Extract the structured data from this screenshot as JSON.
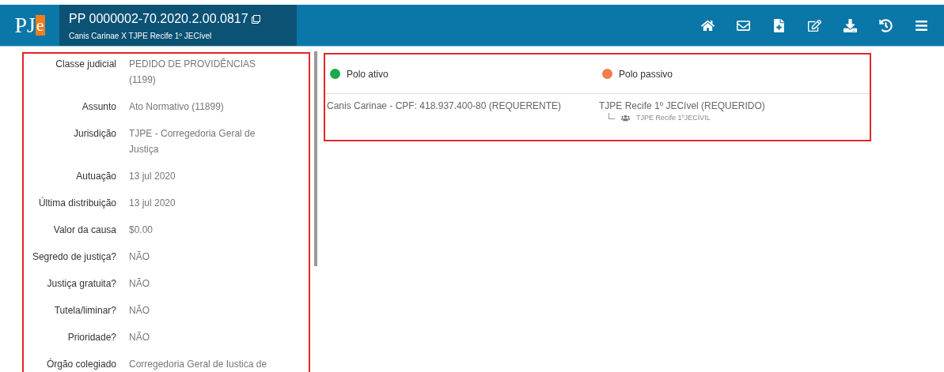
{
  "header": {
    "logo": {
      "p": "PJ",
      "e": "e"
    },
    "process_number": "PP 0000002-70.2020.2.00.0817",
    "parties": "Canis Carinae X TJPE Recife 1º JECível",
    "actions": [
      {
        "kind": "home"
      },
      {
        "kind": "mail"
      },
      {
        "kind": "document"
      },
      {
        "kind": "edit"
      },
      {
        "kind": "download"
      },
      {
        "kind": "history"
      },
      {
        "kind": "menu"
      }
    ]
  },
  "details": [
    {
      "label": "Classe judicial",
      "value": "PEDIDO DE PROVIDÊNCIAS (1199)"
    },
    {
      "label": "Assunto",
      "value": "Ato Normativo (11899)"
    },
    {
      "label": "Jurisdição",
      "value": "TJPE - Corregedoria Geral de Justiça"
    },
    {
      "label": "Autuação",
      "value": "13 jul 2020"
    },
    {
      "label": "Última distribuição",
      "value": "13 jul 2020"
    },
    {
      "label": "Valor da causa",
      "value": "$0.00"
    },
    {
      "label": "Segredo de justiça?",
      "value": "NÃO"
    },
    {
      "label": "Justiça gratuita?",
      "value": "NÃO"
    },
    {
      "label": "Tutela/liminar?",
      "value": "NÃO"
    },
    {
      "label": "Prioridade?",
      "value": "NÃO"
    },
    {
      "label": "Órgão colegiado",
      "value": "Corregedoria Geral de Iustica de"
    }
  ],
  "poles": [
    {
      "title": "Polo ativo",
      "color": "#1ea84a",
      "party": "Canis Carinae - CPF: 418.937.400-80 (REQUERENTE)"
    },
    {
      "title": "Polo passivo",
      "color": "#ef7d4e",
      "party": "TJPE Recife 1º JECível (REQUERIDO)",
      "representative": "TJPE Recife 1ºJECÍVIL"
    }
  ]
}
